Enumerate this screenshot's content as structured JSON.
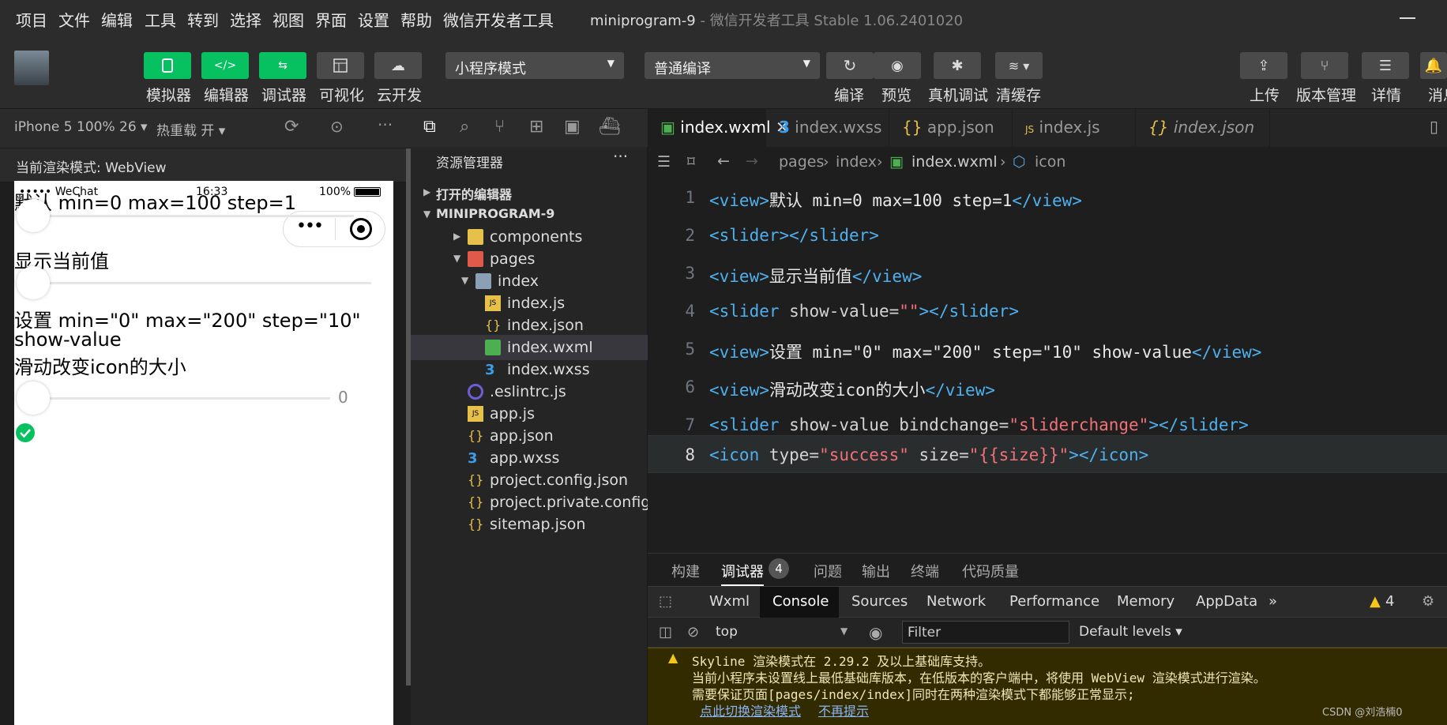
{
  "menu": [
    "项目",
    "文件",
    "编辑",
    "工具",
    "转到",
    "选择",
    "视图",
    "界面",
    "设置",
    "帮助",
    "微信开发者工具"
  ],
  "window": {
    "project": "miniprogram-9",
    "sep": " - ",
    "app": "微信开发者工具 Stable 1.06.2401020"
  },
  "toolbar": {
    "simulator": "模拟器",
    "editor": "编辑器",
    "debugger": "调试器",
    "visual": "可视化",
    "cloud": "云开发",
    "mode": "小程序模式",
    "compile_mode": "普通编译",
    "compile": "编译",
    "preview": "预览",
    "real_debug": "真机调试",
    "clear_cache": "清缓存",
    "upload": "上传",
    "version": "版本管理",
    "details": "详情",
    "message": "消息"
  },
  "sim": {
    "device": "iPhone 5 100% 26 ▾",
    "hotreload": "热重载 开 ▾",
    "render_mode": "当前渲染模式: WebView",
    "status_left": "•••••  WeChat",
    "status_time": "16:33",
    "battery": "100%",
    "t1": "默认 min=0 max=100 step=1",
    "t2": "显示当前值",
    "t3a": "设置 min=\"0\" max=\"200\" step=\"10\"",
    "t3b": "show-value",
    "t4": "滑动改变icon的大小",
    "val2": "0"
  },
  "explorer": {
    "title": "资源管理器",
    "open_editors": "打开的编辑器",
    "project": "MINIPROGRAM-9",
    "items": [
      "components",
      "pages",
      "index",
      "index.js",
      "index.json",
      "index.wxml",
      "index.wxss",
      ".eslintrc.js",
      "app.js",
      "app.json",
      "app.wxss",
      "project.config.json",
      "project.private.config.js...",
      "sitemap.json"
    ]
  },
  "tabs": [
    "index.wxml",
    "index.wxss",
    "app.json",
    "index.js",
    "index.json"
  ],
  "breadcrumb": {
    "p1": "pages",
    "p2": "index",
    "p3": "index.wxml",
    "p4": "icon"
  },
  "code": {
    "l1": [
      "<view>",
      "默认 min=0 max=100 step=1",
      "</view>"
    ],
    "l2": [
      "<slider></slider>"
    ],
    "l3": [
      "<view>",
      "显示当前值",
      "</view>"
    ],
    "l4": [
      "<slider",
      " show-value=",
      "\"\"",
      "></slider>"
    ],
    "l5": [
      "<view>",
      "设置 min=\"0\" max=\"200\" step=\"10\" show-value",
      "</view>"
    ],
    "l6": [
      "<view>",
      "滑动改变icon的大小",
      "</view>"
    ],
    "l7": [
      "<slider",
      " show-value bindchange=",
      "\"sliderchange\"",
      "></slider>"
    ],
    "l8": [
      "<icon",
      " type=",
      "\"success\"",
      " size=",
      "\"{{size}}\"",
      "></icon>"
    ]
  },
  "panel": {
    "tabs": [
      "构建",
      "调试器",
      "问题",
      "输出",
      "终端",
      "代码质量"
    ],
    "badge": "4",
    "devtabs": [
      "Wxml",
      "Console",
      "Sources",
      "Network",
      "Performance",
      "Memory",
      "AppData"
    ],
    "more": "»",
    "warn_count": "4",
    "context": "top",
    "filter": "Filter",
    "levels": "Default levels ▾",
    "w1": "Skyline 渲染模式在 2.29.2 及以上基础库支持。",
    "w2": "当前小程序未设置线上最低基础库版本，在低版本的客户端中，将使用 WebView 渲染模式进行渲染。",
    "w3": "需要保证页面[pages/index/index]同时在两种渲染模式下都能够正常显示;",
    "link1": "点此切换渲染模式",
    "link2": "不再提示",
    "watermark": "CSDN @刘浩楠0"
  },
  "colors": {
    "accent": "#07c160",
    "tag": "#4fb0ee",
    "string": "#f07178"
  }
}
